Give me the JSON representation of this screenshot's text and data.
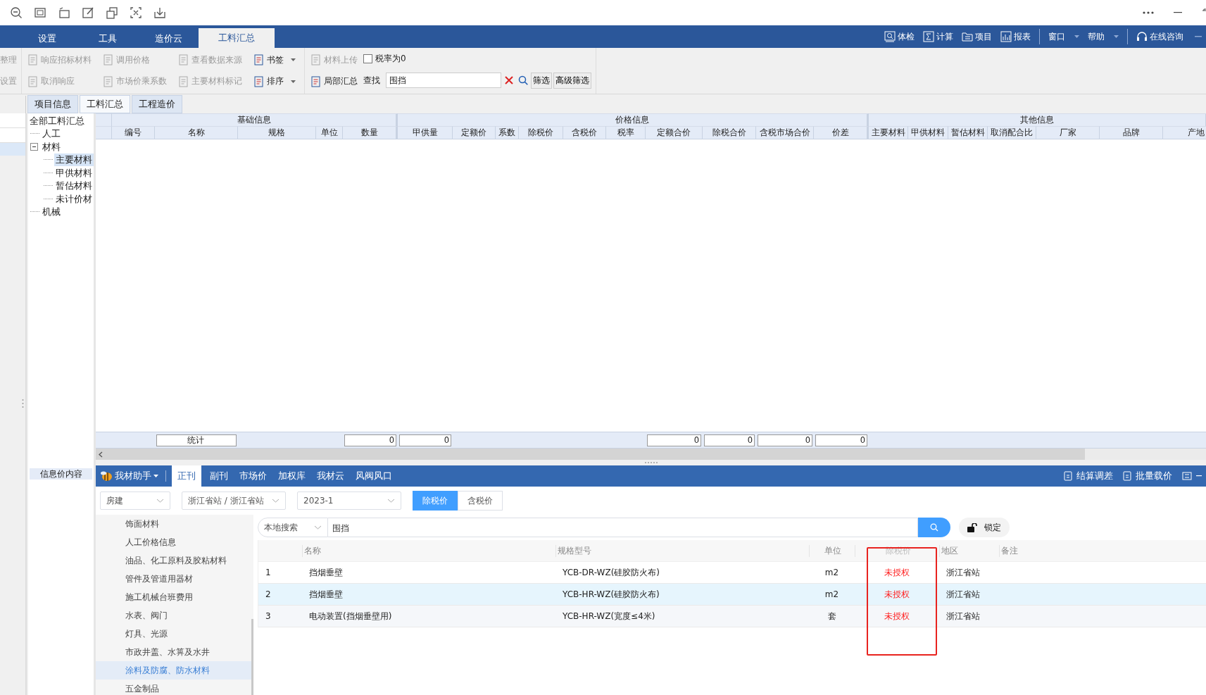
{
  "menu_tabs": [
    {
      "label": "设置",
      "selected": false
    },
    {
      "label": "工具",
      "selected": false
    },
    {
      "label": "造价云",
      "selected": false
    },
    {
      "label": "工料汇总",
      "selected": true
    }
  ],
  "menu_actions": [
    {
      "label": "体检",
      "dropdown": false
    },
    {
      "label": "计算",
      "dropdown": false
    },
    {
      "label": "项目",
      "dropdown": false
    },
    {
      "label": "报表",
      "dropdown": false
    },
    {
      "label": "窗口",
      "dropdown": true
    },
    {
      "label": "帮助",
      "dropdown": true
    },
    {
      "label": "在线咨询",
      "dropdown": false
    }
  ],
  "ribbon": {
    "columns": [
      [
        {
          "label": "整理",
          "disabled": true,
          "dropdown": false
        },
        {
          "label": "设置",
          "disabled": true,
          "dropdown": false
        }
      ],
      [
        {
          "label": "响应招标材料",
          "disabled": true,
          "dropdown": false
        },
        {
          "label": "取消响应",
          "disabled": true,
          "dropdown": false
        }
      ],
      [
        {
          "label": "调用价格",
          "disabled": true,
          "dropdown": false
        },
        {
          "label": "市场价乘系数",
          "disabled": true,
          "dropdown": false
        }
      ],
      [
        {
          "label": "查看数据来源",
          "disabled": true,
          "dropdown": false
        },
        {
          "label": "主要材料标记",
          "disabled": true,
          "dropdown": false
        }
      ],
      [
        {
          "label": "书签",
          "disabled": false,
          "dropdown": true
        },
        {
          "label": "排序",
          "disabled": false,
          "dropdown": true
        }
      ],
      [
        {
          "label": "材料上传",
          "disabled": true,
          "dropdown": false
        },
        {
          "label": "局部汇总",
          "disabled": false,
          "dropdown": false
        }
      ]
    ],
    "checkbox": {
      "label": "税率为0",
      "checked": false
    },
    "find": {
      "label": "查找",
      "value": "围挡"
    },
    "buttons": [
      "筛选",
      "高级筛选"
    ]
  },
  "doc_tabs": [
    {
      "label": "项目信息",
      "selected": false
    },
    {
      "label": "工料汇总",
      "selected": true
    },
    {
      "label": "工程造价",
      "selected": false
    }
  ],
  "tree": {
    "label": "全部工料汇总",
    "selected": false,
    "children": [
      {
        "label": "人工",
        "selected": false
      },
      {
        "label": "材料",
        "selected": false,
        "expanded": true,
        "children": [
          {
            "label": "主要材料",
            "selected": true
          },
          {
            "label": "甲供材料",
            "selected": false
          },
          {
            "label": "暂估材料",
            "selected": false
          },
          {
            "label": "未计价材",
            "selected": false
          }
        ]
      },
      {
        "label": "机械",
        "selected": false
      }
    ]
  },
  "table": {
    "groups": [
      {
        "label": "基础信息",
        "columns": [
          "编号",
          "名称",
          "规格",
          "单位",
          "数量"
        ]
      },
      {
        "label": "价格信息",
        "columns": [
          "甲供量",
          "定额价",
          "系数",
          "除税价",
          "含税价",
          "税率",
          "定额合价",
          "除税合价",
          "含税市场合价",
          "价差"
        ]
      },
      {
        "label": "其他信息",
        "columns": [
          "主要材料",
          "甲供材料",
          "暂估材料",
          "取消配合比",
          "厂家",
          "品牌",
          "产地"
        ]
      }
    ],
    "summary": {
      "label": "统计",
      "values": [
        "0",
        "0",
        "0",
        "0",
        "0",
        "0"
      ]
    }
  },
  "side_label": "信息价内容",
  "helper": {
    "brand": "我材助手",
    "tabs": [
      {
        "label": "正刊",
        "selected": true
      },
      {
        "label": "副刊",
        "selected": false
      },
      {
        "label": "市场价",
        "selected": false
      },
      {
        "label": "加权库",
        "selected": false
      },
      {
        "label": "我材云",
        "selected": false
      },
      {
        "label": "风阀风口",
        "selected": false
      }
    ],
    "actions": [
      "结算调差",
      "批量载价"
    ],
    "selects": [
      "房建",
      "浙江省站 / 浙江省站",
      "2023-1"
    ],
    "price_modes": [
      {
        "label": "除税价",
        "selected": true
      },
      {
        "label": "含税价",
        "selected": false
      }
    ],
    "categories": [
      {
        "label": "饰面材料",
        "selected": false
      },
      {
        "label": "人工价格信息",
        "selected": false
      },
      {
        "label": "油品、化工原料及胶粘材料",
        "selected": false
      },
      {
        "label": "管件及管道用器材",
        "selected": false
      },
      {
        "label": "施工机械台班费用",
        "selected": false
      },
      {
        "label": "水表、阀门",
        "selected": false
      },
      {
        "label": "灯具、光源",
        "selected": false
      },
      {
        "label": "市政井盖、水箅及水井",
        "selected": false
      },
      {
        "label": "涂料及防腐、防水材料",
        "selected": true
      },
      {
        "label": "五金制品",
        "selected": false
      }
    ],
    "search": {
      "scope": "本地搜索",
      "value": "围挡"
    },
    "lock": "锁定",
    "results": {
      "columns": [
        "名称",
        "规格型号",
        "单位",
        "除税价",
        "地区",
        "备注"
      ],
      "rows": [
        {
          "index": "1",
          "name": "挡烟垂壁",
          "spec": "YCB-DR-WZ(硅胶防火布)",
          "unit": "m2",
          "price": "未授权",
          "region": "浙江省站",
          "selected": false
        },
        {
          "index": "2",
          "name": "挡烟垂壁",
          "spec": "YCB-HR-WZ(硅胶防火布)",
          "unit": "m2",
          "price": "未授权",
          "region": "浙江省站",
          "selected": true
        },
        {
          "index": "3",
          "name": "电动装置(挡烟垂壁用)",
          "spec": "YCB-HR-WZ(宽度≤4米)",
          "unit": "套",
          "price": "未授权",
          "region": "浙江省站",
          "selected": false
        }
      ]
    }
  }
}
